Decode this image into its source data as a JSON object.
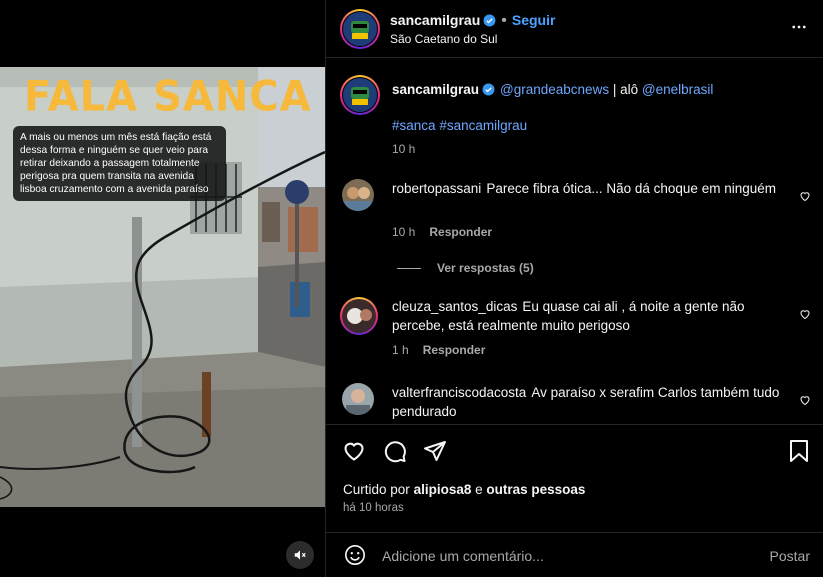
{
  "media": {
    "overlay_title": "FALA SANCA",
    "caption": "A mais ou menos um mês está fiação está dessa forma e ninguém se quer veio para retirar deixando a passagem totalmente perigosa pra quem transita na avenida lisboa cruzamento com a avenida paraíso",
    "mute_icon": "speaker-muted-icon"
  },
  "header": {
    "username": "sancamilgrau",
    "separator": "•",
    "follow_label": "Seguir",
    "location": "São Caetano do Sul",
    "more_icon": "more-horizontal-icon"
  },
  "post_caption": {
    "username": "sancamilgrau",
    "mention_1": "@grandeabcnews",
    "text_mid": "| alô",
    "mention_2": "@enelbrasil",
    "hashtag_1": "#sanca",
    "hashtag_2": "#sancamilgrau",
    "time": "10 h"
  },
  "comments": [
    {
      "username": "robertopassani",
      "text": "Parece fibra ótica... Não dá choque em ninguém",
      "time": "10 h",
      "reply_label": "Responder",
      "view_replies": "Ver respostas (5)"
    },
    {
      "username": "cleuza_santos_dicas",
      "text": "Eu quase cai ali , á noite a gente não percebe, está realmente muito perigoso",
      "time": "1 h",
      "reply_label": "Responder"
    },
    {
      "username": "valterfranciscodacosta",
      "text": "Av paraíso x serafim Carlos também tudo pendurado"
    }
  ],
  "actions": {
    "like_icon": "heart-icon",
    "comment_icon": "comment-icon",
    "share_icon": "share-icon",
    "save_icon": "bookmark-icon",
    "liked_by_prefix": "Curtido por",
    "liked_by_user": "alipiosa8",
    "liked_by_and": "e",
    "liked_by_others": "outras pessoas",
    "time_ago": "há 10 horas"
  },
  "add_comment": {
    "placeholder": "Adicione um comentário...",
    "post_label": "Postar",
    "emoji_icon": "emoji-icon"
  },
  "colors": {
    "background": "#000000",
    "link": "#6fa7ff",
    "follow": "#4aa3ff",
    "muted_text": "#a8a8a8",
    "overlay_title": "#f6b93b"
  }
}
